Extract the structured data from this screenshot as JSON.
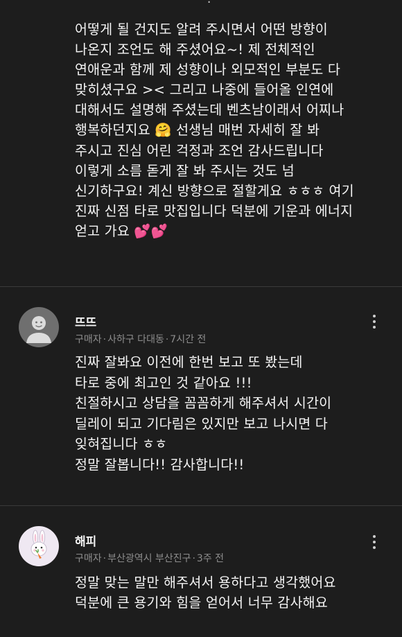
{
  "reviews": [
    {
      "top_fragment": "!",
      "text": "어떻게 될 건지도 알려 주시면서 어떤 방향이\n나온지 조언도 해 주셨어요~! 제 전체적인\n연애운과 함께 제 성향이나 외모적인 부분도 다\n맞히셨구요 >< 그리고 나중에 들어올 인연에\n대해서도 설명해 주셨는데 벤츠남이래서 어찌나\n행복하던지요 🤗 선생님 매번 자세히 잘 봐\n주시고 진심 어린 걱정과 조언 감사드립니다\n이렇게 소름 돋게 잘 봐 주시는 것도 넘\n신기하구요! 계신 방향으로 절할게요 ㅎㅎㅎ 여기\n진짜 신점 타로 맛집입니다 덕분에 기운과 에너지\n얻고 가요 💕💕"
    },
    {
      "username": "뜨뜨",
      "buyer": "구매자",
      "location": "사하구 다대동",
      "time": "7시간 전",
      "separator": "·",
      "avatar_icon": "default-profile-icon",
      "text": "진짜 잘봐요 이전에 한번 보고 또 봤는데\n타로 중에 최고인 것 같아요 !!!\n친절하시고 상담을 꼼꼼하게 해주셔서 시간이\n딜레이 되고 기다림은 있지만 보고 나시면 다\n잊혀집니다 ㅎㅎ\n정말 잘봅니다!! 감사합니다!!"
    },
    {
      "username": "해피",
      "buyer": "구매자",
      "location": "부산광역시 부산진구",
      "time": "3주 전",
      "separator": "·",
      "avatar_icon": "bunny-carrot-icon",
      "text": "정말 맞는 말만 해주셔서 용하다고 생각했어요\n덕분에 큰 용기와 힘을 얻어서 너무 감사해요"
    }
  ],
  "icons": {
    "more": "more-vertical-icon"
  },
  "colors": {
    "background": "#1d1d1d",
    "text": "#f4f4f4",
    "meta": "#8d8d8d",
    "divider": "#3a3a3a",
    "avatar_default": "#6f6f6f",
    "bunny_avatar_bg": "#efe8f2",
    "carrot": "#f07a2a"
  }
}
